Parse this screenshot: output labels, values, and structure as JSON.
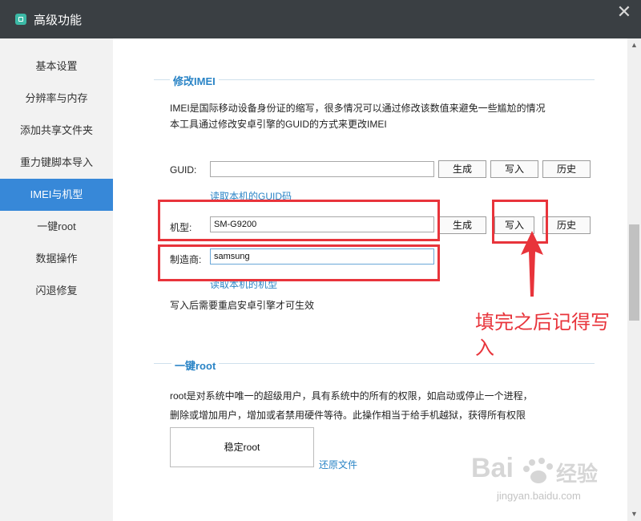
{
  "window": {
    "title": "高级功能",
    "close_glyph": "✕"
  },
  "sidebar": {
    "items": [
      {
        "label": "基本设置"
      },
      {
        "label": "分辨率与内存"
      },
      {
        "label": "添加共享文件夹"
      },
      {
        "label": "重力键脚本导入"
      },
      {
        "label": "IMEI与机型",
        "active": true
      },
      {
        "label": "一键root"
      },
      {
        "label": "数据操作"
      },
      {
        "label": "闪退修复"
      }
    ]
  },
  "imei_section": {
    "title": "修改IMEI",
    "desc_line1": "IMEI是国际移动设备身份证的缩写，很多情况可以通过修改该数值来避免一些尴尬的情况",
    "desc_line2": "本工具通过修改安卓引擎的GUID的方式来更改IMEI",
    "guid": {
      "label": "GUID:",
      "value": ""
    },
    "read_guid_link": "读取本机的GUID码",
    "model": {
      "label": "机型:",
      "value": "SM-G9200"
    },
    "manufacturer": {
      "label": "制造商:",
      "value": "samsung"
    },
    "read_model_link": "读取本机的机型",
    "note": "写入后需要重启安卓引擎才可生效",
    "buttons": {
      "generate": "生成",
      "write": "写入",
      "history": "历史"
    }
  },
  "root_section": {
    "title": "一键root",
    "desc_line1": "root是对系统中唯一的超级用户，具有系统中的所有的权限，如启动或停止一个进程，",
    "desc_line2": "删除或增加用户，增加或者禁用硬件等待。此操作相当于给手机越狱，获得所有权限",
    "stable_root_button": "稳定root",
    "restore_link": "还原文件"
  },
  "annotation": {
    "line1": "填完之后记得写",
    "line2": "入",
    "color": "#e8343b"
  },
  "watermark": {
    "brand_left": "Bai",
    "brand_right": "经验",
    "url": "jingyan.baidu.com"
  }
}
